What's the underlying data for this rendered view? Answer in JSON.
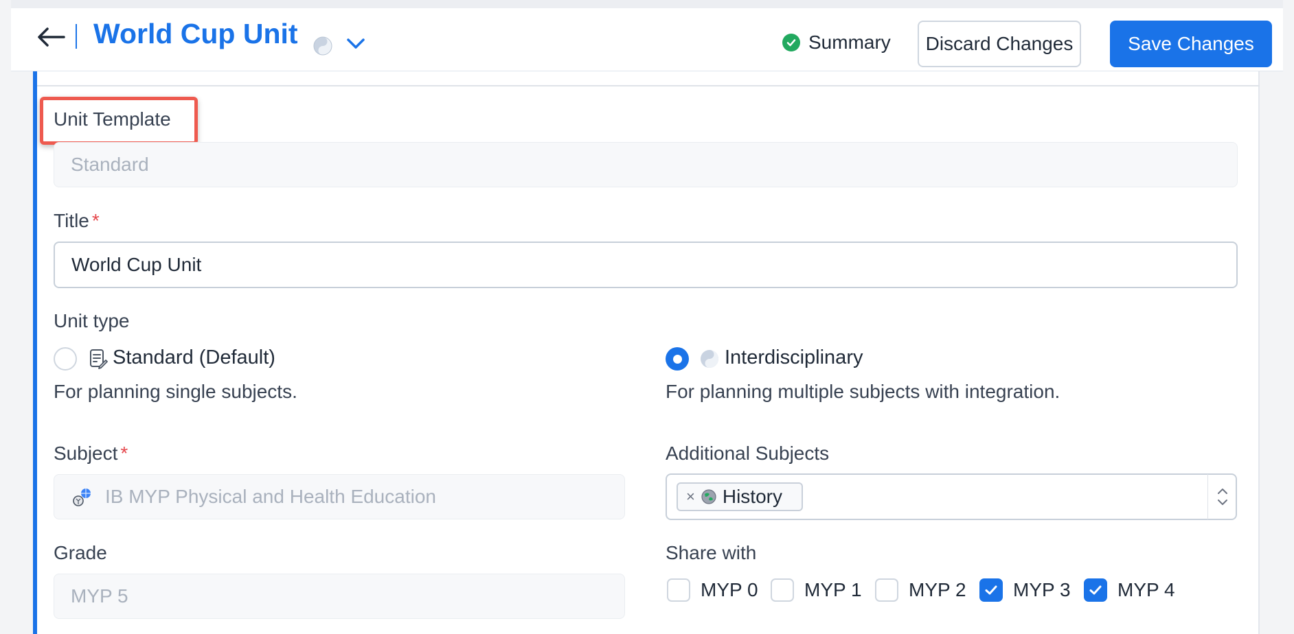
{
  "header": {
    "title": "World Cup Unit",
    "summary_label": "Summary",
    "discard_label": "Discard Changes",
    "save_label": "Save Changes"
  },
  "form": {
    "unit_template": {
      "label": "Unit Template",
      "value": "Standard"
    },
    "title": {
      "label": "Title",
      "required_mark": "*",
      "value": "World Cup Unit"
    },
    "unit_type": {
      "label": "Unit type",
      "options": [
        {
          "label": "Standard (Default)",
          "description": "For planning single subjects.",
          "selected": false
        },
        {
          "label": "Interdisciplinary",
          "description": "For planning multiple subjects with integration.",
          "selected": true
        }
      ]
    },
    "subject": {
      "label": "Subject",
      "required_mark": "*",
      "value": "IB MYP Physical and Health Education"
    },
    "additional_subjects": {
      "label": "Additional Subjects",
      "tags": [
        "History"
      ],
      "remove_symbol": "×"
    },
    "grade": {
      "label": "Grade",
      "value": "MYP 5"
    },
    "share_with": {
      "label": "Share with",
      "options": [
        {
          "label": "MYP 0",
          "checked": false
        },
        {
          "label": "MYP 1",
          "checked": false
        },
        {
          "label": "MYP 2",
          "checked": false
        },
        {
          "label": "MYP 3",
          "checked": true
        },
        {
          "label": "MYP 4",
          "checked": true
        }
      ]
    }
  },
  "colors": {
    "accent": "#1a73e8",
    "success": "#22a95f",
    "required": "#e5484d",
    "highlight": "#ee5a4f"
  },
  "icons": {
    "back": "arrow-left-icon",
    "title_type": "interdisciplinary-icon",
    "dropdown": "chevron-down-icon",
    "summary": "check-circle-icon",
    "standard": "document-icon",
    "subject": "sports-icon",
    "history": "globe-icon",
    "select": "up-down-chevron-icon"
  }
}
